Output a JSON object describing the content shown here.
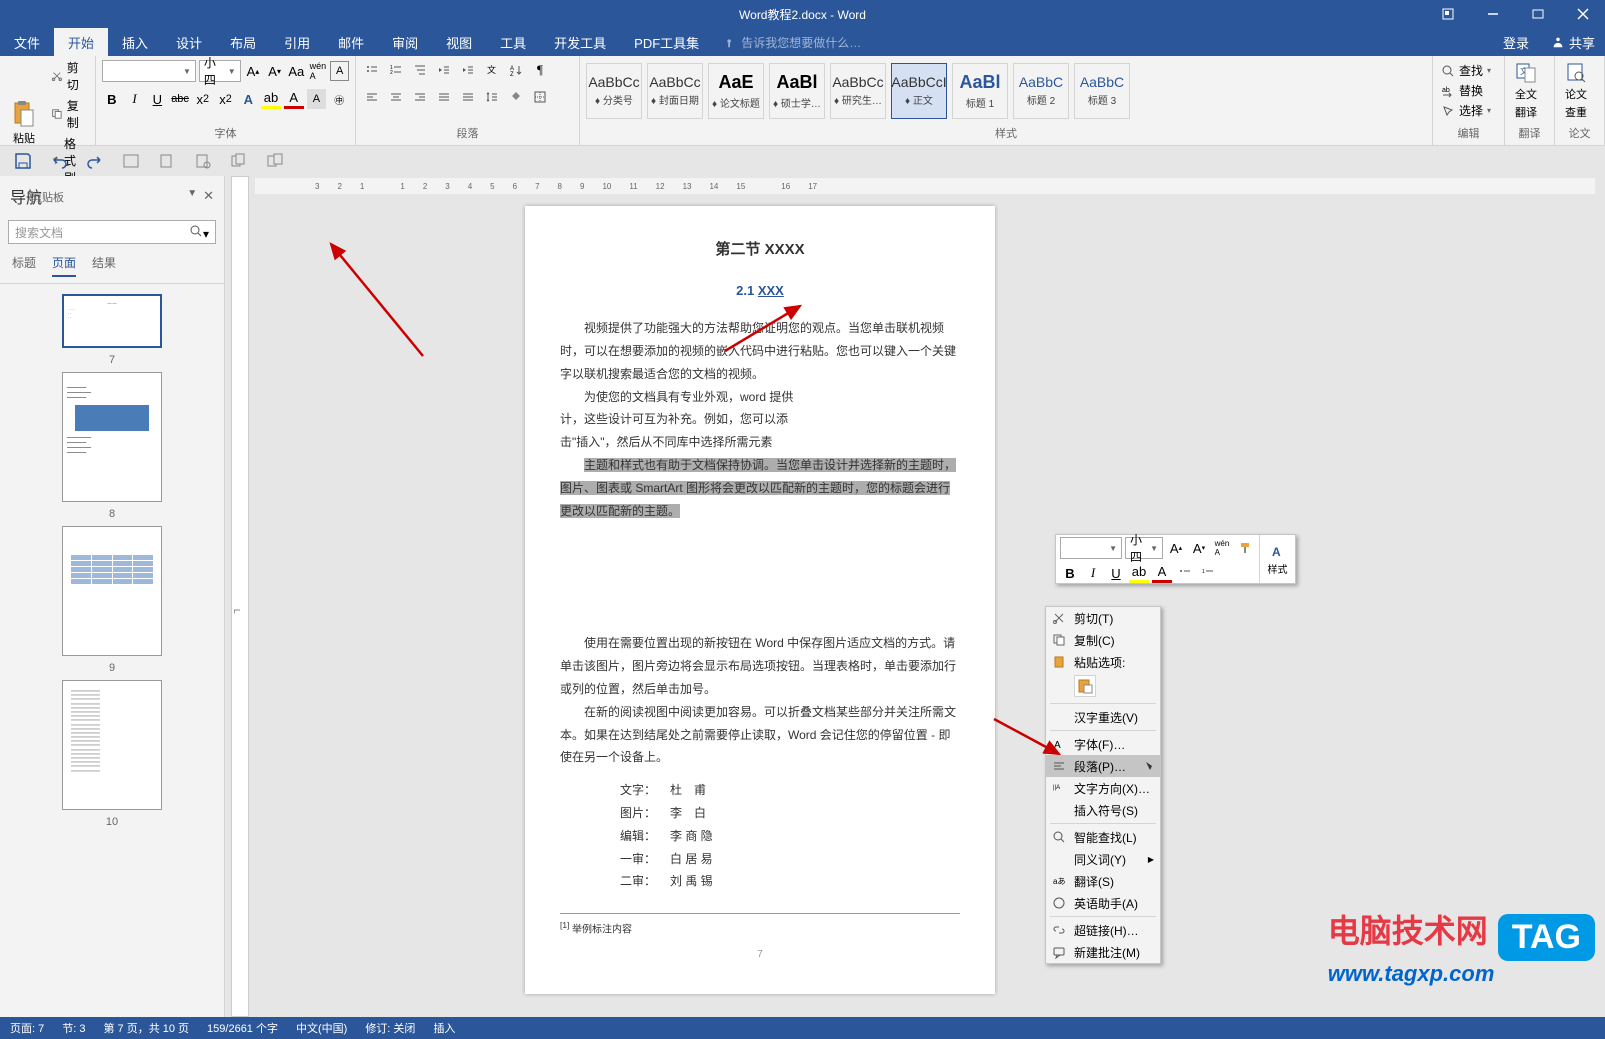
{
  "title_bar": {
    "title": "Word教程2.docx - Word"
  },
  "menu": {
    "items": [
      "文件",
      "开始",
      "插入",
      "设计",
      "布局",
      "引用",
      "邮件",
      "审阅",
      "视图",
      "工具",
      "开发工具",
      "PDF工具集"
    ],
    "active": "开始",
    "tell_me": "告诉我您想要做什么…",
    "login": "登录",
    "share": "共享"
  },
  "ribbon": {
    "clipboard": {
      "label": "剪贴板",
      "paste": "粘贴",
      "cut": "剪切",
      "copy": "复制",
      "format_painter": "格式刷"
    },
    "font": {
      "label": "字体",
      "name": "",
      "size": "小四",
      "buttons": {
        "bold": "B",
        "italic": "I",
        "underline": "U",
        "strike": "abc",
        "sub": "x₂",
        "sup": "x²"
      }
    },
    "paragraph": {
      "label": "段落"
    },
    "styles": {
      "label": "样式",
      "items": [
        {
          "preview": "AaBbCc",
          "name": "♦ 分类号"
        },
        {
          "preview": "AaBbCc",
          "name": "♦ 封面日期"
        },
        {
          "preview": "AaE",
          "name": "♦ 论文标题",
          "big": true
        },
        {
          "preview": "AaBl",
          "name": "♦ 硕士学…",
          "big": true
        },
        {
          "preview": "AaBbCc",
          "name": "♦ 研究生…"
        },
        {
          "preview": "AaBbCcI",
          "name": "♦ 正文",
          "active": true
        },
        {
          "preview": "AaBl",
          "name": "标题 1",
          "big": true,
          "blue": true
        },
        {
          "preview": "AaBbC",
          "name": "标题 2",
          "blue": true
        },
        {
          "preview": "AaBbC",
          "name": "标题 3",
          "blue": true
        }
      ]
    },
    "editing": {
      "label": "编辑",
      "find": "查找",
      "replace": "替换",
      "select": "选择"
    },
    "translate": {
      "label": "翻译",
      "full": "全文",
      "translate": "翻译"
    },
    "thesis": {
      "label": "论文",
      "check": "论文",
      "review": "查重"
    }
  },
  "nav": {
    "title": "导航",
    "search_placeholder": "搜索文档",
    "tabs": {
      "headings": "标题",
      "pages": "页面",
      "results": "结果"
    },
    "thumbs": [
      {
        "n": "7",
        "sel": true
      },
      {
        "n": "8"
      },
      {
        "n": "9"
      },
      {
        "n": "10"
      }
    ]
  },
  "document": {
    "chapter_title": "第二节  XXXX",
    "section_title_prefix": "2.1 ",
    "section_title": "XXX",
    "p1": "视频提供了功能强大的方法帮助您证明您的观点。当您单击联机视频时，可以在想要添加的视频的嵌入代码中进行粘贴。您也可以键入一个关键字以联机搜索最适合您的文档的视频。",
    "p2a": "为使您的文档具有专业外观，word 提供",
    "p2b": "计，这些设计可互为补充。例如，您可以添",
    "p2c": "击\"插入\"，然后从不同库中选择所需元素",
    "p3": "主题和样式也有助于文档保持协调。当您单击设计并选择新的主题时，图片、图表或 SmartArt 图形将会更改以匹配新的主题时，您的标题会进行更改以匹配新的主题。",
    "p4": "使用在需要位置出现的新按钮在 Word 中保存图片适应文档的方式。请单击该图片，图片旁边将会显示布局选项按钮。当理表格时，单击要添加行或列的位置，然后单击加号。",
    "p5": "在新的阅读视图中阅读更加容易。可以折叠文档某些部分并关注所需文本。如果在达到结尾处之前需要停止读取，Word 会记住您的停留位置 - 即使在另一个设备上。",
    "credits": [
      {
        "label": "文字：",
        "value": "杜　甫"
      },
      {
        "label": "图片：",
        "value": "李　白"
      },
      {
        "label": "编辑：",
        "value": "李 商 隐"
      },
      {
        "label": "一审：",
        "value": "白 居 易"
      },
      {
        "label": "二审：",
        "value": "刘 禹 锡"
      }
    ],
    "footnote": "举例标注内容",
    "page_num": "7"
  },
  "mini_toolbar": {
    "font": "",
    "size": "小四",
    "style": "样式"
  },
  "context_menu": {
    "cut": "剪切(T)",
    "copy": "复制(C)",
    "paste_options": "粘贴选项:",
    "hanzi": "汉字重选(V)",
    "font": "字体(F)…",
    "paragraph": "段落(P)…",
    "text_direction": "文字方向(X)…",
    "insert_symbol": "插入符号(S)",
    "smart_lookup": "智能查找(L)",
    "synonyms": "同义词(Y)",
    "translate": "翻译(S)",
    "english_assistant": "英语助手(A)",
    "hyperlink": "超链接(H)…",
    "new_comment": "新建批注(M)"
  },
  "status": {
    "page": "页面: 7",
    "section": "节: 3",
    "page_of": "第 7 页，共 10 页",
    "words": "159/2661 个字",
    "lang": "中文(中国)",
    "track": "修订: 关闭",
    "insert": "插入"
  },
  "watermark": {
    "line1": "电脑技术网",
    "line2": "www.tagxp.com",
    "tag": "TAG"
  }
}
